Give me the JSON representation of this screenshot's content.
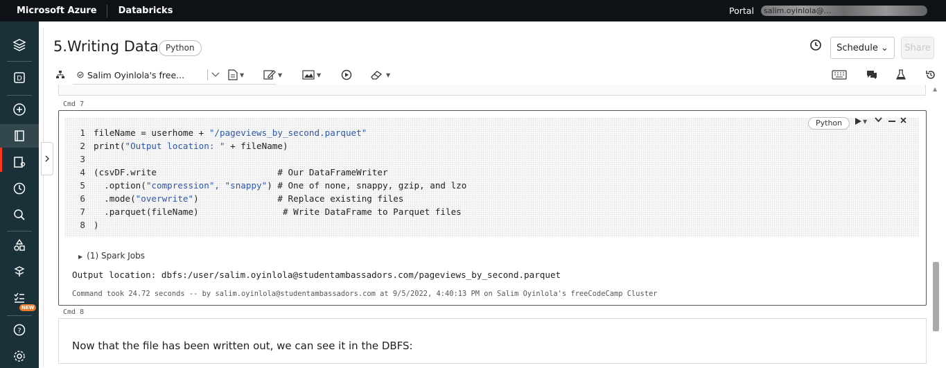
{
  "topbar": {
    "brand": "Microsoft Azure",
    "product": "Databricks",
    "portal": "Portal",
    "user": "salim.oyinlola@..."
  },
  "notebook": {
    "title": "5.Writing Data",
    "language": "Python"
  },
  "header": {
    "schedule_label": "Schedule ⌄",
    "share_label": "Share"
  },
  "toolbar": {
    "cluster": "Salim Oyinlola's free..."
  },
  "cells": {
    "prev_label": "Cmd 7",
    "next_label": "Cmd 8",
    "code_cell": {
      "language": "Python",
      "lines": [
        {
          "n": "1",
          "a": "fileName = userhome + ",
          "s": "\"/pageviews_by_second.parquet\"",
          "c": ""
        },
        {
          "n": "2",
          "a": "print(",
          "s": "\"Output location: \"",
          "c": " + fileName)"
        },
        {
          "n": "3",
          "a": "",
          "s": "",
          "c": ""
        },
        {
          "n": "4",
          "a": "(csvDF.write                       # Our DataFrameWriter",
          "s": "",
          "c": ""
        },
        {
          "n": "5",
          "a": "  .option(",
          "s": "\"compression\", \"snappy\"",
          "c": ") # One of none, snappy, gzip, and lzo"
        },
        {
          "n": "6",
          "a": "  .mode(",
          "s": "\"overwrite\"",
          "c": ")               # Replace existing files"
        },
        {
          "n": "7",
          "a": "  .parquet(fileName)                # Write DataFrame to Parquet files",
          "s": "",
          "c": ""
        },
        {
          "n": "8",
          "a": ")",
          "s": "",
          "c": ""
        }
      ],
      "spark_jobs": "(1) Spark Jobs",
      "output": "Output location: dbfs:/user/salim.oyinlola@studentambassadors.com/pageviews_by_second.parquet",
      "took": "Command took 24.72 seconds -- by salim.oyinlola@studentambassadors.com at 9/5/2022, 4:40:13 PM on Salim Oyinlola's freeCodeCamp Cluster"
    },
    "md_cell": {
      "text": "Now that the file has been written out, we can see it in the DBFS:"
    }
  },
  "sidebar": {
    "new_badge": "NEW"
  },
  "colors": {
    "sidebar": "#1b3139",
    "topbar": "#0e1116",
    "accent": "#ff3621",
    "string": "#2f57a8"
  }
}
